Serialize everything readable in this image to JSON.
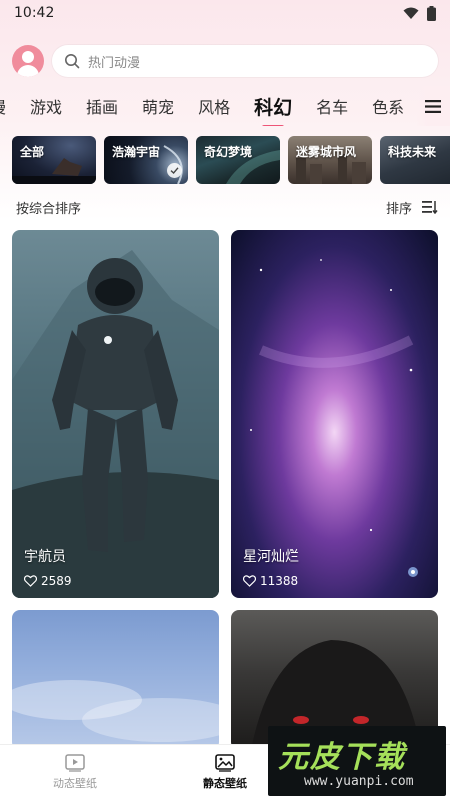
{
  "status_bar": {
    "time": "10:42",
    "icons": [
      "wifi-icon",
      "battery-icon"
    ]
  },
  "search": {
    "placeholder": "热门动漫",
    "icon": "search-icon"
  },
  "category_tabs": [
    {
      "label": "漫",
      "partial": true
    },
    {
      "label": "游戏"
    },
    {
      "label": "插画"
    },
    {
      "label": "萌宠"
    },
    {
      "label": "风格"
    },
    {
      "label": "科幻",
      "active": true
    },
    {
      "label": "名车"
    },
    {
      "label": "色系"
    }
  ],
  "sub_categories": [
    {
      "label": "全部"
    },
    {
      "label": "浩瀚宇宙",
      "selected": true
    },
    {
      "label": "奇幻梦境"
    },
    {
      "label": "迷雾城市风"
    },
    {
      "label": "科技未来"
    }
  ],
  "sort": {
    "left_label": "按综合排序",
    "right_label": "排序"
  },
  "wallpapers": [
    {
      "title": "宇航员",
      "likes": "2589"
    },
    {
      "title": "星河灿烂",
      "likes": "11388"
    },
    {
      "title": "",
      "likes": ""
    },
    {
      "title": "",
      "likes": ""
    }
  ],
  "bottom_nav": [
    {
      "label": "动态壁纸",
      "icon": "play-video-icon",
      "active": false
    },
    {
      "label": "静态壁纸",
      "icon": "image-icon",
      "active": true
    }
  ],
  "watermark": {
    "main": "元皮下载",
    "url": "www.yuanpi.com"
  },
  "colors": {
    "accent": "#ee5577",
    "avatar": "#f08c9c"
  }
}
